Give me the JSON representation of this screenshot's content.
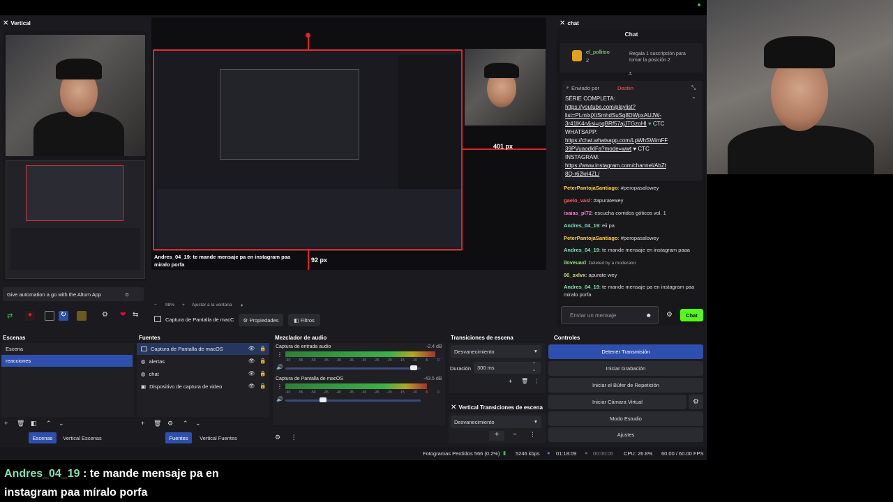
{
  "preview": {
    "vertical_title": "Vertical",
    "width_label": "401 px",
    "height_label": "92 px",
    "zoom": "98%",
    "fit_label": "Ajustar a la ventana",
    "caption_user": "Andres_04_19",
    "caption_text": ": te mande mensaje pa en instagram paa miralo porfa",
    "altum_text": "Give automation a go with the Altum App",
    "altum_count": "0"
  },
  "source_bar": {
    "source_name": "Captura de Pantalla de macC",
    "props_label": "Propiedades",
    "filters_label": "Filtros"
  },
  "scenes": {
    "title": "Escenas",
    "items": [
      "Escena",
      "reacciones"
    ],
    "tab1": "Escenas",
    "tab2": "Vertical Escenas"
  },
  "sources": {
    "title": "Fuentes",
    "items": [
      "Captura de Pantalla de macOS",
      "alertas",
      "chat",
      "Dispositivo de captura de video"
    ],
    "tab1": "Fuentes",
    "tab2": "Vertical Fuentes"
  },
  "mixer": {
    "title": "Mezclador de audio",
    "ch1_name": "Captura de entrada audio",
    "ch1_db": "-2.4 dB",
    "ch2_name": "Captura de Pantalla de macOS",
    "ch2_db": "-43.5 dB",
    "scale": [
      "-60",
      "-55",
      "-50",
      "-45",
      "-40",
      "-35",
      "-30",
      "-25",
      "-20",
      "-15",
      "-10",
      "-5",
      "0"
    ],
    "ch1_level": 0.95,
    "ch1_vol": 0.95,
    "ch2_level": 0.9,
    "ch2_vol": 0.28
  },
  "transitions": {
    "title": "Transiciones de escena",
    "selected": "Desvanecimiento",
    "duration_label": "Duración",
    "duration_value": "300 ms",
    "vertical_title": "Vertical Transiciones de escena",
    "vertical_selected": "Desvanecimiento"
  },
  "controls": {
    "title": "Controles",
    "stop_stream": "Detener Transmisión",
    "start_record": "Iniciar Grabación",
    "replay_buffer": "Iniciar el Búfer de Repetición",
    "virtual_cam": "Iniciar Cámara Virtual",
    "studio": "Modo Estudio",
    "settings": "Ajustes"
  },
  "status": {
    "dropped": "Fotogramas Perdidos 566 (0.2%)",
    "bitrate": "5246 kbps",
    "stream_time": "01:18:09",
    "rec_time": "00:00:00",
    "cpu": "CPU: 26.8%",
    "fps": "60.00 / 60.00 FPS"
  },
  "chat": {
    "dock_title": "chat",
    "title": "Chat",
    "gifter": "el_pollitoo",
    "gifter_count": "2",
    "gift_text": "Regala 1 suscripción para tomar la posición 2",
    "pinned_by": "Enviado por",
    "pinned_user": "Destiin",
    "pinned_lines": [
      "SÉRIE COMPLETA:",
      "https://youtube.com/playlist?",
      "list=PLmlxjXtSmhdSuSq8DWpxAUJW-",
      "3r41lK4n&si=pqBRf57ajJTGzoHI",
      "CTC",
      "WHATSAPP:",
      "https://chat.whatsapp.com/LpWhSWimFF",
      "39PVuaodklFa?mode=wwt",
      "CTC",
      "INSTAGRAM:",
      "https://www.instagram.com/channel/AbZt",
      "8Q-r62kri4ZL/"
    ],
    "messages": [
      {
        "user": "PeterPantojaSantiago",
        "text": ": #peropasalowey",
        "color": "#ffd24a"
      },
      {
        "user": "gaelo_vasl",
        "text": ": #apuratewey",
        "color": "#ff5a5a"
      },
      {
        "user": "isaias_pl72",
        "text": ": escucha corridos góticos vol. 1",
        "color": "#ff7ad9"
      },
      {
        "user": "Andres_04_19",
        "text": ": eii pa",
        "color": "#7fe3b0"
      },
      {
        "user": "PeterPantojaSantiago",
        "text": ": #peropasalowey",
        "color": "#ffd24a"
      },
      {
        "user": "Andres_04_19",
        "text": ": te mande mensaje en instagram paaa",
        "color": "#7fe3b0"
      },
      {
        "user": "iloveuaxl",
        "text": ": Deleted by a moderator",
        "color": "#9be37f"
      },
      {
        "user": "00_sxlvx",
        "text": ": apurate wey",
        "color": "#c9e37f"
      },
      {
        "user": "Andres_04_19",
        "text": ": te mande mensaje pa en instagram paa miralo porfa",
        "color": "#7fe3b0"
      }
    ],
    "input_placeholder": "Enviar un mensaje",
    "send_label": "Chat"
  },
  "overlay": {
    "user": "Andres_04_19",
    "line1": ": te mande mensaje pa en",
    "line2": "instagram paa míralo porfa"
  },
  "colors": {
    "accent_blue": "#2f4fae",
    "selection_red": "#e0242c",
    "chat_green": "#53fc18"
  }
}
